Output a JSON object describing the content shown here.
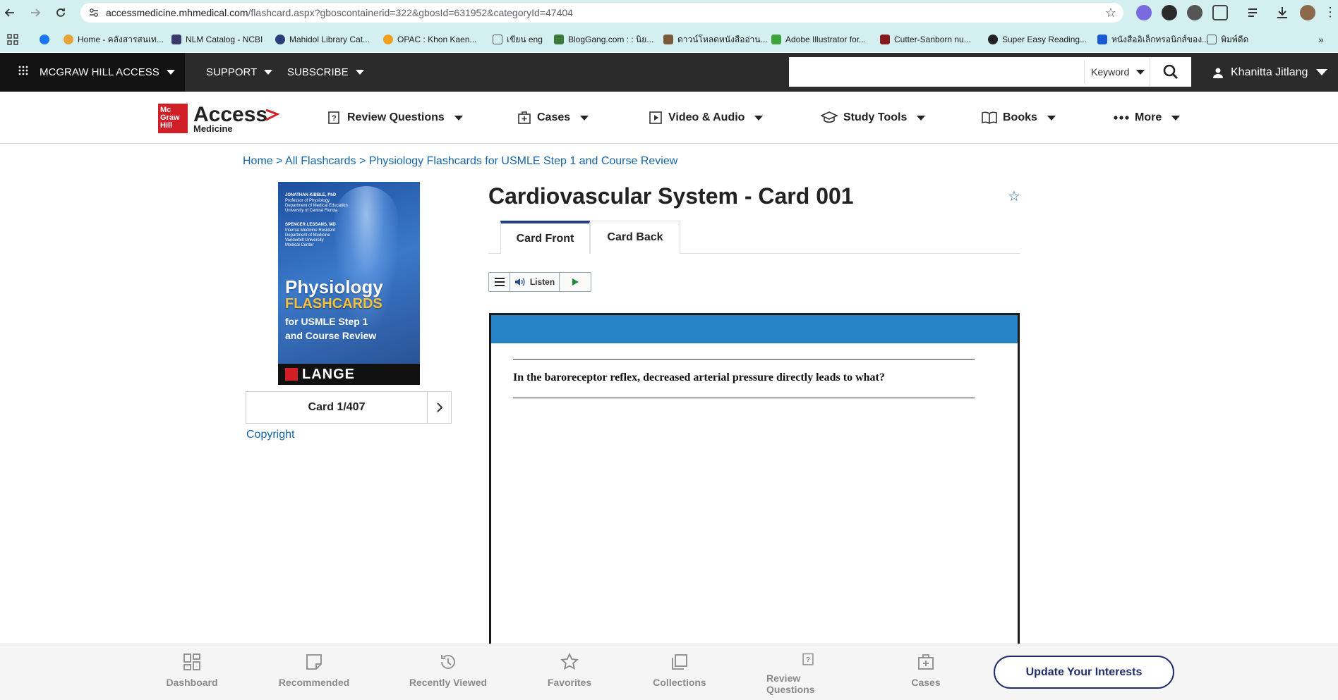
{
  "browser": {
    "url_host": "accessmedicine.mhmedical.com",
    "url_path": "/flashcard.aspx?gboscontainerid=322&gbosId=631952&categoryId=47404",
    "bookmarks": [
      {
        "label": "Home - คลังสารสนเท...",
        "icon_color": "#e5a33a"
      },
      {
        "label": "NLM Catalog - NCBI",
        "icon_color": "#3a3a6a"
      },
      {
        "label": "Mahidol Library Cat...",
        "icon_color": "#2a3d7a"
      },
      {
        "label": "OPAC : Khon Kaen...",
        "icon_color": "#f0a020"
      },
      {
        "label": "เขียน eng",
        "icon_color": "#666666"
      },
      {
        "label": "BlogGang.com : : นิย...",
        "icon_color": "#3a7a3a"
      },
      {
        "label": "ดาวน์โหลดหนังสืออ่าน...",
        "icon_color": "#7a5a3a"
      },
      {
        "label": "Adobe Illustrator for...",
        "icon_color": "#3aa43a"
      },
      {
        "label": "Cutter-Sanborn nu...",
        "icon_color": "#8a1a1a"
      },
      {
        "label": "Super Easy Reading...",
        "icon_color": "#222222"
      },
      {
        "label": "หนังสืออิเล็กทรอนิกส์ของ...",
        "icon_color": "#1a5ad8"
      },
      {
        "label": "พิมพ์ดีด",
        "icon_color": "#666666"
      }
    ]
  },
  "header": {
    "brand": "MCGRAW HILL ACCESS",
    "support": "SUPPORT",
    "subscribe": "SUBSCRIBE",
    "search_placeholder": "",
    "keyword": "Keyword",
    "user": "Khanitta Jitlang"
  },
  "logo": {
    "mgh": [
      "Mc",
      "Graw",
      "Hill"
    ],
    "access": "Access",
    "medicine": "Medicine"
  },
  "nav": {
    "items": [
      "Review Questions",
      "Cases",
      "Video & Audio",
      "Study Tools",
      "Books",
      "More"
    ]
  },
  "breadcrumb": {
    "home": "Home",
    "sep": ">",
    "all": "All Flashcards",
    "current": "Physiology Flashcards for USMLE Step 1 and Course Review"
  },
  "book": {
    "author1": [
      "JONATHAN KIBBLE, PhD",
      "Professor of Physiology",
      "Department of Medical Education",
      "University of Central Florida"
    ],
    "author2": [
      "SPENCER LESSANS, MD",
      "Internal Medicine Resident",
      "Department of Medicine",
      "Vanderbilt University",
      "Medical Center"
    ],
    "title": "Physiology",
    "subtitle": "FLASHCARDS",
    "line1": "for USMLE Step 1",
    "line2": "and Course Review",
    "imprint": "LANGE"
  },
  "card_nav": {
    "count": "Card 1/407",
    "copyright": "Copyright"
  },
  "card": {
    "title": "Cardiovascular System - Card 001",
    "tab_front": "Card Front",
    "tab_back": "Card Back",
    "listen": "Listen",
    "question": "In the baroreceptor reflex, decreased arterial pressure directly leads to what?"
  },
  "bottom": {
    "items": [
      "Dashboard",
      "Recommended",
      "Recently Viewed",
      "Favorites",
      "Collections",
      "Review Questions",
      "Cases"
    ],
    "update": "Update Your Interests"
  },
  "colors": {
    "accent_blue": "#2683c6",
    "link_blue": "#1565a8",
    "header_dark": "#2b2b2b",
    "brand_red": "#d21f27",
    "navy": "#1f2d6b"
  }
}
